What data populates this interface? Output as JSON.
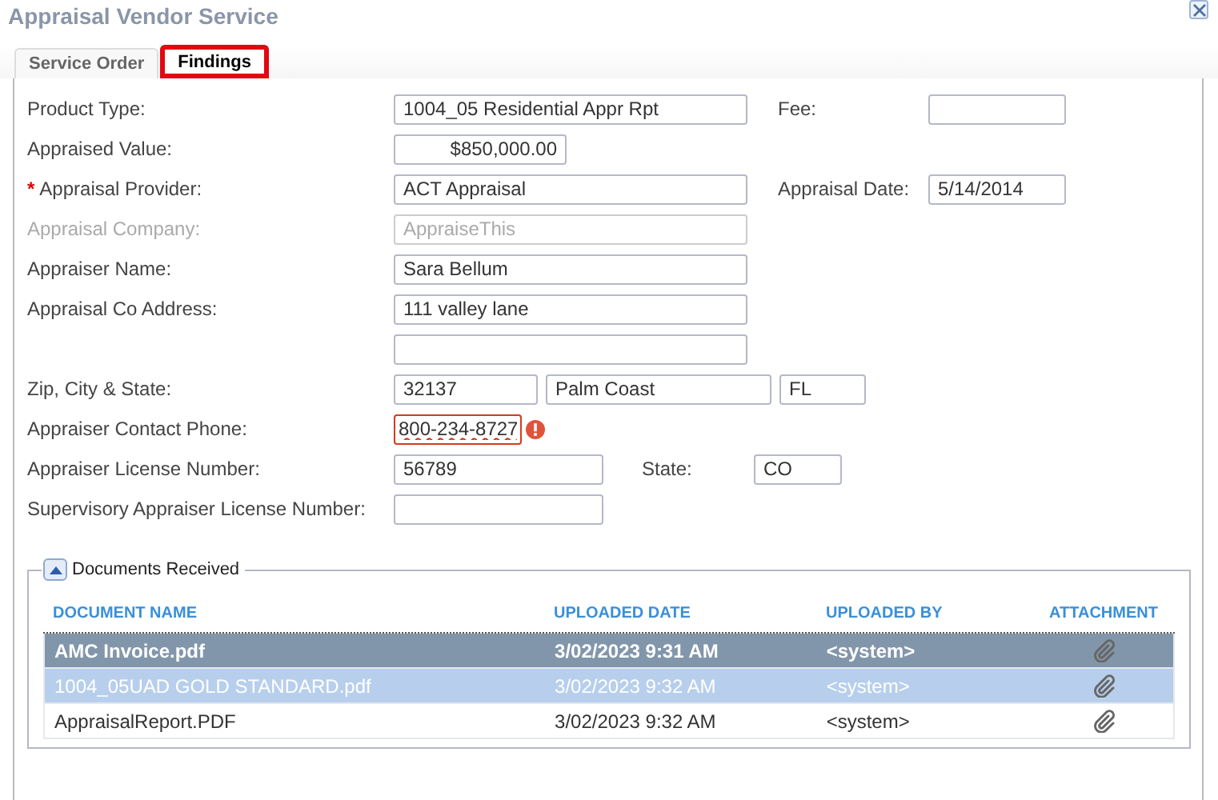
{
  "window": {
    "title": "Appraisal Vendor Service"
  },
  "tabs": [
    {
      "label": "Service Order",
      "selected": false,
      "annotated": false
    },
    {
      "label": "Findings",
      "selected": true,
      "annotated": true
    }
  ],
  "form": {
    "rows": [
      {
        "label": "Product Type:",
        "disabled": false,
        "fields": [
          {
            "kind": "text",
            "value": "1004_05 Residential Appr Rpt",
            "invalid": false
          }
        ],
        "side": {
          "label": "Fee:",
          "field": {
            "kind": "short",
            "invalid": false
          }
        }
      },
      {
        "label": "Appraised Value:",
        "disabled": false,
        "fields": [
          {
            "kind": "money",
            "value": "$850,000.00",
            "invalid": false
          }
        ]
      },
      {
        "marker": "*",
        "label": "Appraisal Provider:",
        "disabled": false,
        "fields": [
          {
            "kind": "text",
            "value": "ACT Appraisal",
            "invalid": false
          }
        ],
        "side": {
          "label": "Appraisal Date:",
          "field": {
            "kind": "short",
            "value": "5/14/2014",
            "invalid": false
          }
        }
      },
      {
        "label": "Appraisal Company:",
        "disabled": true,
        "fields": [
          {
            "kind": "text",
            "value": "AppraiseThis",
            "invalid": false
          }
        ]
      },
      {
        "label": "Appraiser Name:",
        "disabled": false,
        "fields": [
          {
            "kind": "text",
            "value": "Sara Bellum",
            "invalid": false
          }
        ]
      },
      {
        "label": "Appraisal Co Address:",
        "disabled": false,
        "fields": [
          {
            "kind": "text",
            "value": "111 valley lane",
            "invalid": false
          }
        ]
      },
      {
        "fields": [
          {
            "kind": "text",
            "invalid": false
          }
        ]
      },
      {
        "label": "Zip, City & State:",
        "disabled": false,
        "fields": [
          {
            "kind": "zip",
            "value": "32137",
            "invalid": false
          },
          {
            "kind": "city",
            "value": "Palm Coast",
            "invalid": false
          },
          {
            "kind": "st",
            "value": "FL",
            "invalid": false
          }
        ]
      },
      {
        "label": "Appraiser Contact Phone:",
        "disabled": false,
        "fields": [
          {
            "kind": "phone",
            "value": "800-234-8727",
            "invalid": true
          }
        ]
      },
      {
        "label": "Appraiser License Number:",
        "disabled": false,
        "fields": [
          {
            "kind": "license",
            "value": "56789",
            "invalid": false
          }
        ],
        "side": {
          "label": "State:",
          "field": {
            "kind": "state",
            "value": "CO",
            "invalid": false
          }
        }
      },
      {
        "label": "Supervisory Appraiser License Number:",
        "disabled": false,
        "fields": [
          {
            "kind": "license",
            "invalid": false
          }
        ]
      }
    ]
  },
  "documents": {
    "title": "Documents Received",
    "expanded": true,
    "columns": [
      "DOCUMENT NAME",
      "UPLOADED DATE",
      "UPLOADED BY",
      "ATTACHMENT"
    ],
    "rows": [
      {
        "name": "AMC Invoice.pdf",
        "date": "3/02/2023 9:31 AM",
        "by": "<system>",
        "selected": true,
        "hovered": false
      },
      {
        "name": "1004_05UAD GOLD STANDARD.pdf",
        "date": "3/02/2023 9:32 AM",
        "by": "<system>",
        "selected": false,
        "hovered": true
      },
      {
        "name": "AppraisalReport.PDF",
        "date": "3/02/2023 9:32 AM",
        "by": "<system>",
        "selected": false,
        "hovered": false
      }
    ]
  }
}
